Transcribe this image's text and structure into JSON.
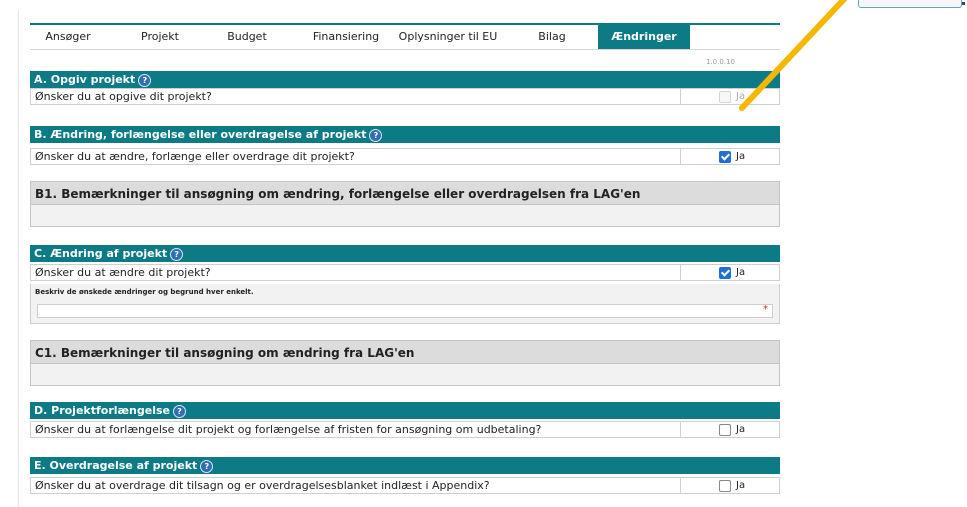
{
  "tabs": [
    {
      "label": "Ansøger",
      "active": false
    },
    {
      "label": "Projekt",
      "active": false
    },
    {
      "label": "Budget",
      "active": false
    },
    {
      "label": "Finansiering",
      "active": false
    },
    {
      "label": "Oplysninger til EU",
      "active": false
    },
    {
      "label": "Bilag",
      "active": false
    },
    {
      "label": "Ændringer",
      "active": true
    }
  ],
  "version": "1.0.0.10",
  "colors": {
    "teal": "#0c7b86",
    "gray_header": "#dcdcdc",
    "check_blue": "#1f6fd6",
    "arrow": "#f5b800",
    "required": "#d21f1f"
  },
  "sections": {
    "a": {
      "title": "A. Opgiv projekt",
      "question": "Ønsker du at opgive dit projekt?",
      "checkbox_label": "Ja",
      "checked": false,
      "disabled": true
    },
    "b": {
      "title": "B. Ændring, forlængelse eller overdragelse af projekt",
      "question": "Ønsker du at ændre, forlænge eller overdrage dit projekt?",
      "checkbox_label": "Ja",
      "checked": true
    },
    "b1": {
      "title": "B1. Bemærkninger til ansøgning om ændring, forlængelse eller overdragelsen fra LAG'en"
    },
    "c": {
      "title": "C. Ændring af projekt",
      "question": "Ønsker du at ændre dit projekt?",
      "checkbox_label": "Ja",
      "checked": true,
      "desc_label": "Beskriv de ønskede ændringer og begrund hver enkelt.",
      "required_mark": "*"
    },
    "c1": {
      "title": "C1. Bemærkninger til ansøgning om ændring fra LAG'en"
    },
    "d": {
      "title": "D. Projektforlængelse",
      "question": "Ønsker du at forlængelse dit projekt og forlængelse af fristen for ansøgning om udbetaling?",
      "checkbox_label": "Ja",
      "checked": false
    },
    "e": {
      "title": "E. Overdragelse af projekt",
      "question": "Ønsker du at overdrage dit tilsagn og er overdragelsesblanket indlæst i Appendix?",
      "checkbox_label": "Ja",
      "checked": false
    }
  },
  "icons": {
    "help": "help-icon",
    "arrow": "annotation-arrow"
  }
}
